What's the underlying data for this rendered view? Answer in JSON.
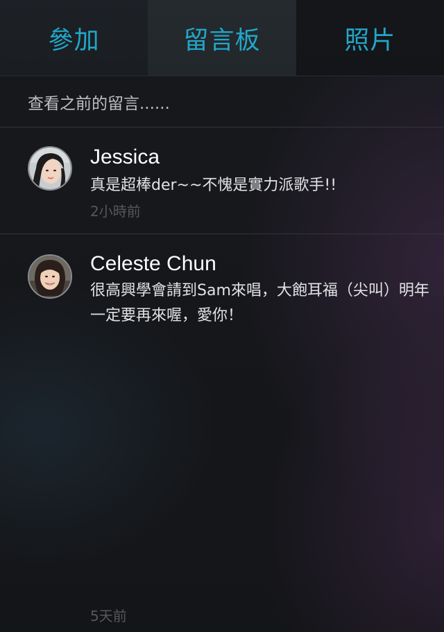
{
  "tabs": [
    {
      "label": "參加"
    },
    {
      "label": "留言板",
      "active": true
    },
    {
      "label": "照片"
    }
  ],
  "view_previous": "查看之前的留言......",
  "comments": [
    {
      "author": "Jessica",
      "text": "真是超棒der~~不愧是實力派歌手!!",
      "time": "2小時前",
      "avatar": "avatar-photo"
    },
    {
      "author": "Celeste Chun",
      "text": "很高興學會請到Sam來唱，大飽耳福（尖叫）明年一定要再來喔，愛你！",
      "time": "5天前",
      "avatar": "avatar-photo"
    }
  ],
  "colors": {
    "accent": "#22a6c8",
    "background": "#151619",
    "text_primary": "#ffffff",
    "text_secondary": "#e2e3e6",
    "text_muted": "#55575c",
    "divider": "#33353a"
  }
}
